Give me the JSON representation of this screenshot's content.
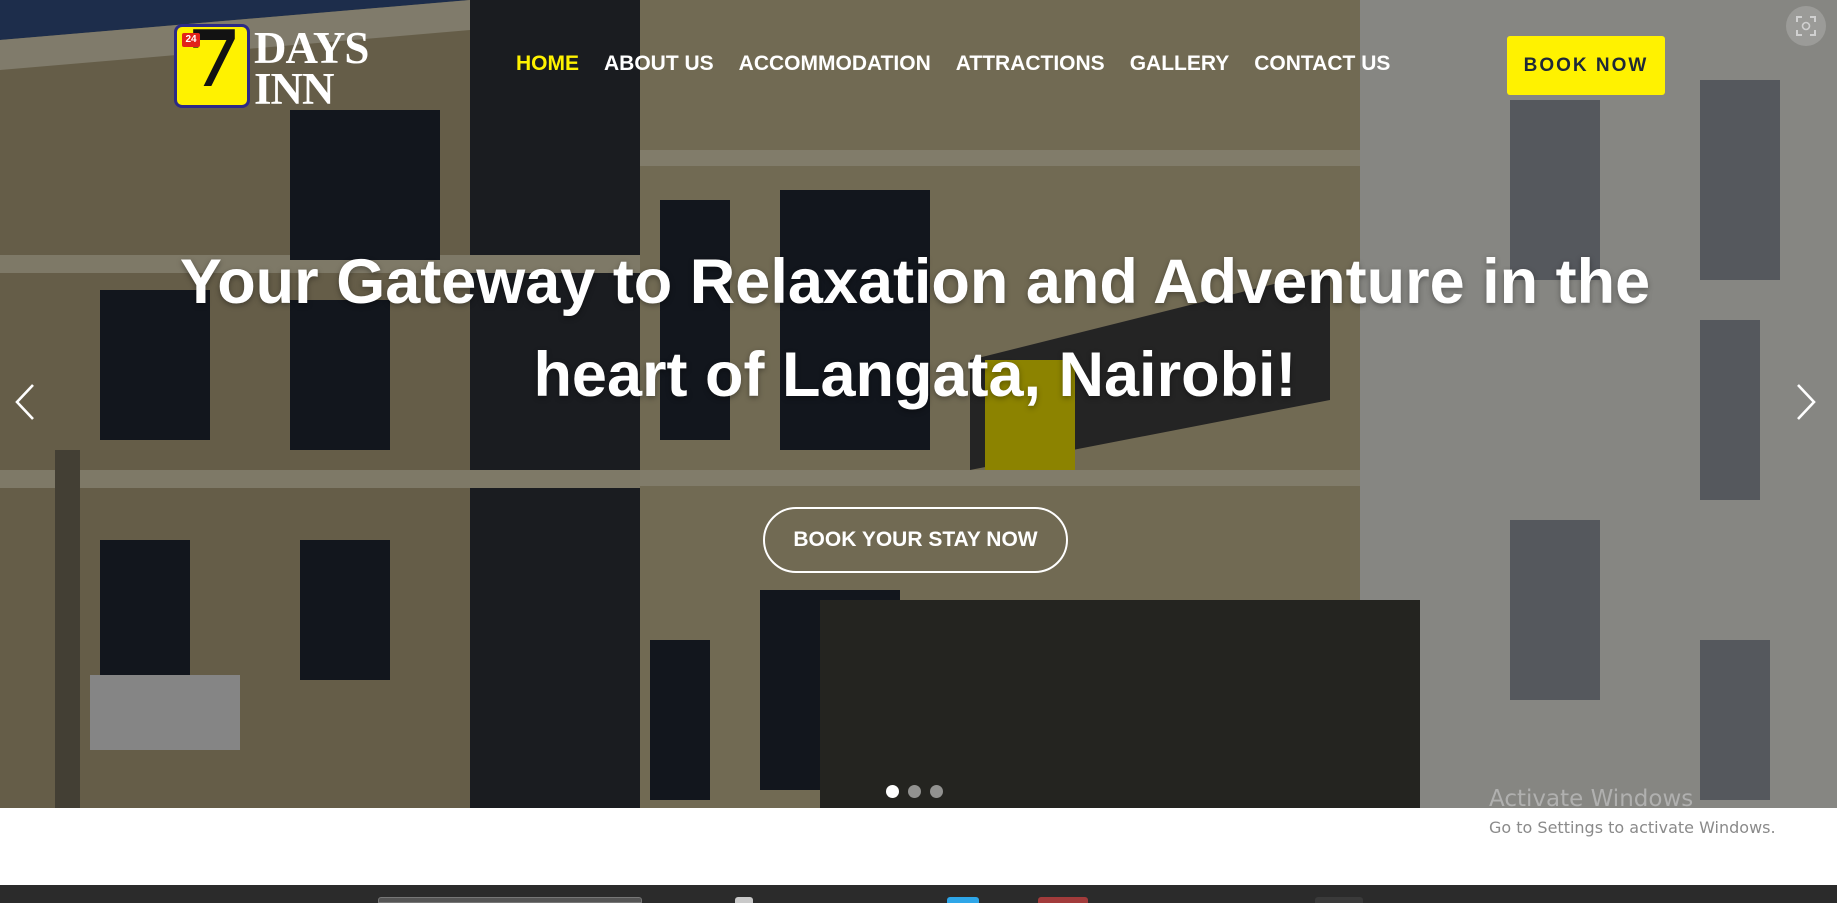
{
  "header": {
    "logo": {
      "badge_number": "7",
      "badge_tag": "24",
      "word_top": "DAYS",
      "word_bottom": "INN"
    },
    "nav": [
      {
        "label": "HOME",
        "active": true
      },
      {
        "label": "ABOUT US",
        "active": false
      },
      {
        "label": "ACCOMMODATION",
        "active": false
      },
      {
        "label": "ATTRACTIONS",
        "active": false
      },
      {
        "label": "GALLERY",
        "active": false
      },
      {
        "label": "CONTACT US",
        "active": false
      }
    ],
    "book_now_label": "BOOK NOW"
  },
  "hero": {
    "headline_line1": "Your Gateway to Relaxation and Adventure in the",
    "headline_line2": "heart of Langata, Nairobi!",
    "cta_label": "BOOK YOUR STAY NOW",
    "slides_total": 3,
    "active_slide": 1,
    "prev_icon": "chevron-left-icon",
    "next_icon": "chevron-right-icon"
  },
  "watermark": {
    "title": "Activate Windows",
    "subtitle": "Go to Settings to activate Windows."
  },
  "colors": {
    "accent": "#fff200",
    "logo_border": "#2c2a86",
    "text": "#ffffff"
  }
}
